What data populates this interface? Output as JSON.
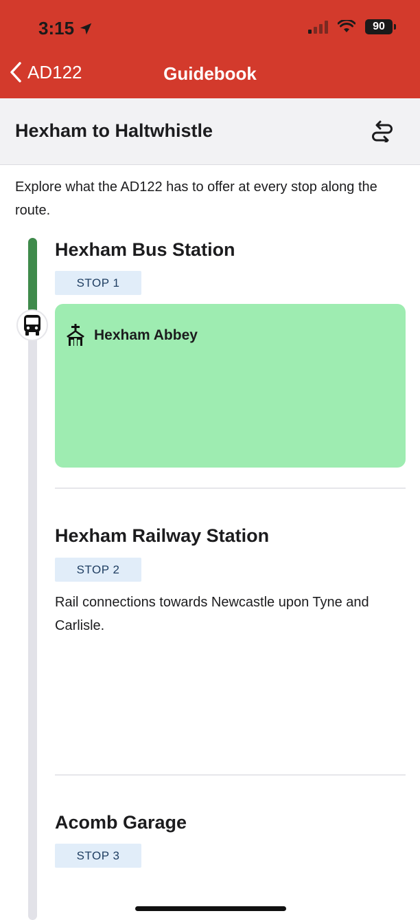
{
  "status_bar": {
    "time": "3:15",
    "battery": "90"
  },
  "nav": {
    "back_label": "AD122",
    "title": "Guidebook"
  },
  "route": {
    "title": "Hexham to Haltwhistle"
  },
  "intro": "Explore what the AD122 has to offer at every stop along the route.",
  "stops": [
    {
      "name": "Hexham Bus Station",
      "badge": "STOP 1",
      "poi": "Hexham Abbey"
    },
    {
      "name": "Hexham Railway Station",
      "badge": "STOP 2",
      "description": "Rail connections towards Newcastle upon Tyne and Carlisle."
    },
    {
      "name": "Acomb Garage",
      "badge": "STOP 3"
    }
  ],
  "colors": {
    "header": "#d33a2c",
    "progress": "#3f8a4b",
    "poi_card": "#9eecb1",
    "badge_bg": "#e1edf9"
  }
}
